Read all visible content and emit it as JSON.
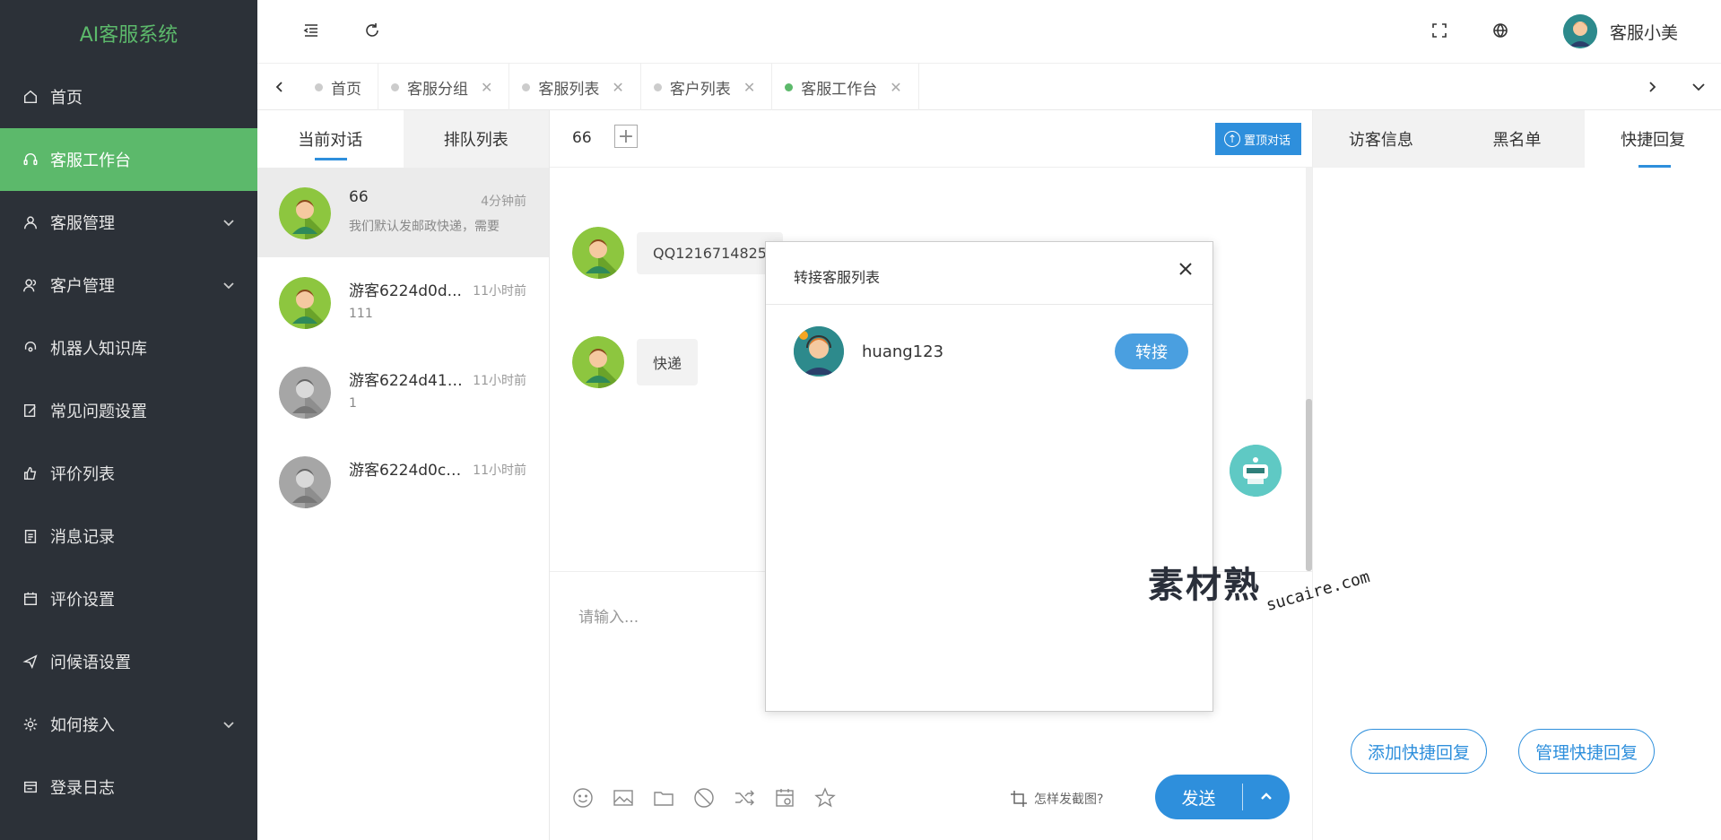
{
  "app": {
    "title": "AI客服系统",
    "brand_color": "#5cb96b",
    "accent_color": "#2e8fdc"
  },
  "sidebar": {
    "items": [
      {
        "label": "首页",
        "icon": "home-icon"
      },
      {
        "label": "客服工作台",
        "icon": "headset-icon",
        "active": true
      },
      {
        "label": "客服管理",
        "icon": "user-icon",
        "expandable": true
      },
      {
        "label": "客户管理",
        "icon": "users-icon",
        "expandable": true
      },
      {
        "label": "机器人知识库",
        "icon": "robot-icon"
      },
      {
        "label": "常见问题设置",
        "icon": "edit-icon"
      },
      {
        "label": "评价列表",
        "icon": "thumb-icon"
      },
      {
        "label": "消息记录",
        "icon": "clipboard-icon"
      },
      {
        "label": "评价设置",
        "icon": "calendar-icon"
      },
      {
        "label": "问候语设置",
        "icon": "send-icon"
      },
      {
        "label": "如何接入",
        "icon": "settings-icon",
        "expandable": true
      },
      {
        "label": "登录日志",
        "icon": "log-icon"
      }
    ]
  },
  "header": {
    "user_name": "客服小美"
  },
  "tabs": [
    {
      "label": "首页",
      "closable": false
    },
    {
      "label": "客服分组",
      "closable": true
    },
    {
      "label": "客服列表",
      "closable": true
    },
    {
      "label": "客户列表",
      "closable": true
    },
    {
      "label": "客服工作台",
      "closable": true,
      "active": true
    }
  ],
  "conversations": {
    "tabs": [
      "当前对话",
      "排队列表"
    ],
    "items": [
      {
        "name": "66",
        "time": "4分钟前",
        "message": "我们默认发邮政快递，需要",
        "avatar": "color"
      },
      {
        "name": "游客6224d0d...",
        "time": "11小时前",
        "message": "111",
        "avatar": "color"
      },
      {
        "name": "游客6224d41f...",
        "time": "11小时前",
        "message": "1",
        "avatar": "gray"
      },
      {
        "name": "游客6224d0c1...",
        "time": "11小时前",
        "message": "",
        "avatar": "gray"
      }
    ]
  },
  "chat": {
    "title": "66",
    "pin_label": "置顶对话",
    "messages": [
      "QQ1216714825",
      "快递"
    ],
    "input_placeholder": "请输入...",
    "screenshot_hint": "怎样发截图?",
    "send_label": "发送"
  },
  "right_panel": {
    "tabs": [
      "访客信息",
      "黑名单",
      "快捷回复"
    ],
    "add_label": "添加快捷回复",
    "manage_label": "管理快捷回复"
  },
  "modal": {
    "title": "转接客服列表",
    "agent_name": "huang123",
    "transfer_label": "转接"
  },
  "watermark": {
    "cn": "素材熟",
    "en": "sucaire.com"
  }
}
